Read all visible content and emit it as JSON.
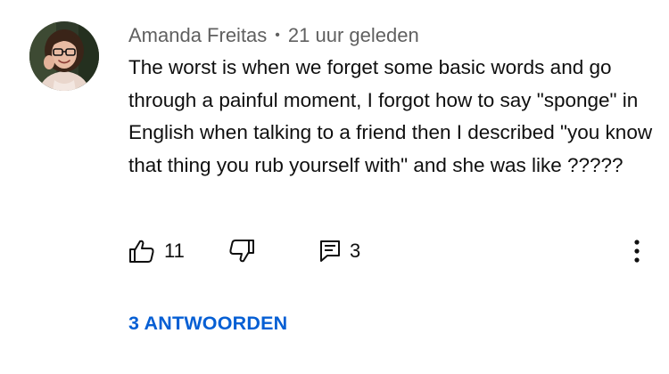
{
  "comment": {
    "author": "Amanda Freitas",
    "separator": "•",
    "timestamp": "21 uur geleden",
    "text": "The worst is when we forget some basic words and go through a painful moment, I forgot how to say \"sponge\" in English when talking to a friend then I described \"you know that thing you rub yourself with\" and she was like ?????",
    "like_count": "11",
    "reply_count": "3",
    "replies_link": "3 ANTWOORDEN"
  },
  "icons": {
    "like": "thumbs-up-icon",
    "dislike": "thumbs-down-icon",
    "reply": "comment-icon",
    "more": "more-vertical-icon"
  },
  "colors": {
    "meta_text": "#606060",
    "body_text": "#0f0f0f",
    "link": "#065fd4"
  }
}
